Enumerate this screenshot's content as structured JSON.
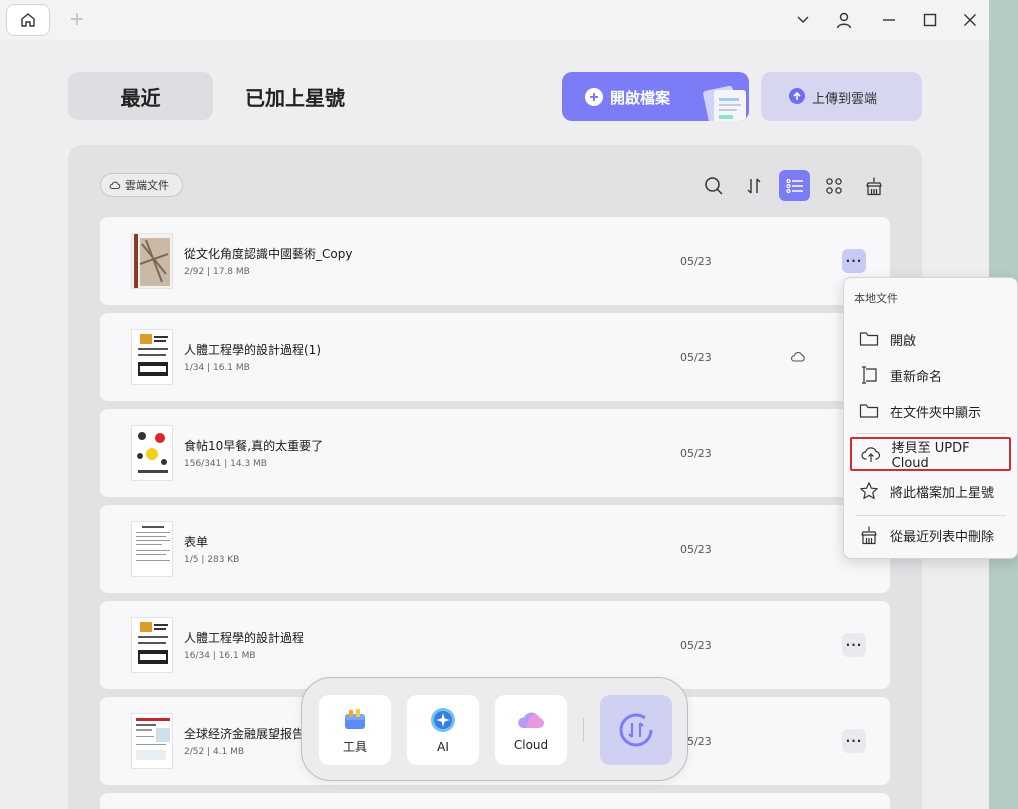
{
  "tabs": {
    "recent": "最近",
    "starred": "已加上星號"
  },
  "actions": {
    "open_file": "開啟檔案",
    "upload_cloud": "上傳到雲端"
  },
  "filter": {
    "cloud_docs": "雲端文件"
  },
  "toolbar_icons": [
    "search-icon",
    "sort-icon",
    "list-view-icon",
    "grid-view-icon",
    "clean-icon"
  ],
  "files": [
    {
      "name": "從文化角度認識中國藝術_Copy",
      "meta": "2/92 | 17.8 MB",
      "date": "05/23"
    },
    {
      "name": "人體工程學的設計過程(1)",
      "meta": "1/34 | 16.1 MB",
      "date": "05/23"
    },
    {
      "name": "食帖10早餐,真的太重要了",
      "meta": "156/341 | 14.3 MB",
      "date": "05/23"
    },
    {
      "name": "表单",
      "meta": "1/5 | 283 KB",
      "date": "05/23"
    },
    {
      "name": "人體工程學的設計過程",
      "meta": "16/34 | 16.1 MB",
      "date": "05/23"
    },
    {
      "name": "全球经济金融展望报告",
      "meta": "2/52 | 4.1 MB",
      "date": "05/23"
    }
  ],
  "more_label": "···",
  "context_menu": {
    "header": "本地文件",
    "items": [
      {
        "label": "開啟",
        "icon": "folder-icon"
      },
      {
        "label": "重新命名",
        "icon": "rename-icon"
      },
      {
        "label": "在文件夾中顯示",
        "icon": "folder-icon"
      },
      {
        "label": "拷貝至 UPDF Cloud",
        "icon": "cloud-upload-icon",
        "highlighted": true
      },
      {
        "label": "將此檔案加上星號",
        "icon": "star-icon"
      },
      {
        "label": "從最近列表中刪除",
        "icon": "clean-icon"
      }
    ]
  },
  "dock": {
    "tools": "工具",
    "ai": "AI",
    "cloud": "Cloud"
  },
  "colors": {
    "accent": "#7b7cf6",
    "highlight_border": "#d62c2c"
  }
}
